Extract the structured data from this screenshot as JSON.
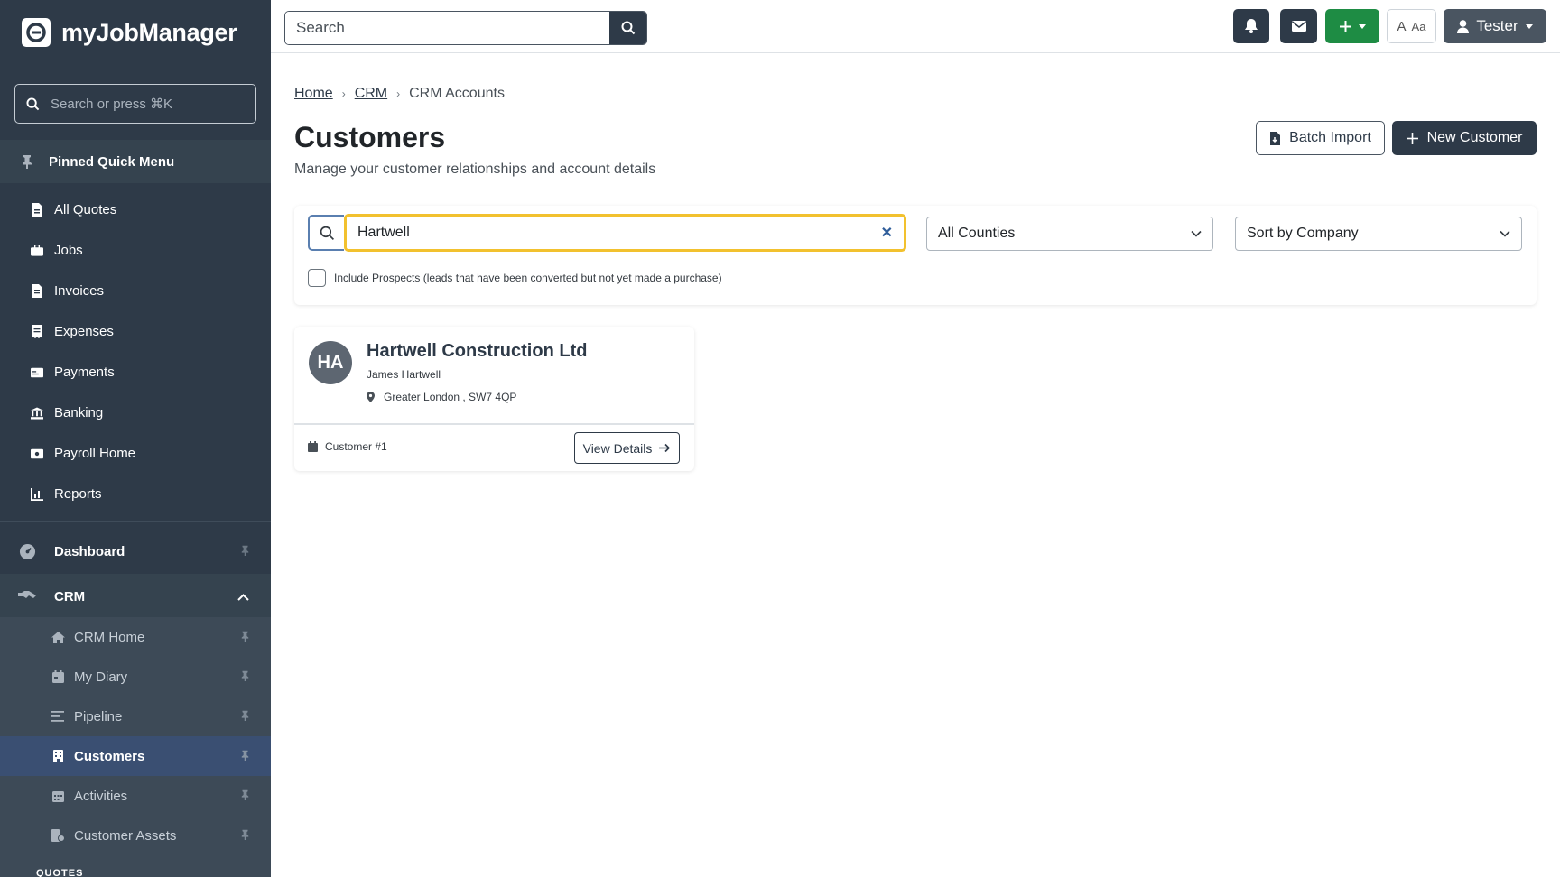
{
  "app": {
    "name": "myJobManager"
  },
  "sidebar": {
    "search_placeholder": "Search or press ⌘K",
    "pinned_title": "Pinned Quick Menu",
    "quick_items": [
      {
        "label": "All Quotes",
        "icon": "file-icon"
      },
      {
        "label": "Jobs",
        "icon": "briefcase-icon"
      },
      {
        "label": "Invoices",
        "icon": "invoice-icon"
      },
      {
        "label": "Expenses",
        "icon": "receipt-icon"
      },
      {
        "label": "Payments",
        "icon": "card-icon"
      },
      {
        "label": "Banking",
        "icon": "bank-icon"
      },
      {
        "label": "Payroll Home",
        "icon": "money-icon"
      },
      {
        "label": "Reports",
        "icon": "chart-icon"
      }
    ],
    "dashboard_label": "Dashboard",
    "crm_label": "CRM",
    "crm_items": [
      {
        "label": "CRM Home",
        "icon": "home-icon"
      },
      {
        "label": "My Diary",
        "icon": "calendar-icon"
      },
      {
        "label": "Pipeline",
        "icon": "list-icon"
      },
      {
        "label": "Customers",
        "icon": "building-icon",
        "active": true
      },
      {
        "label": "Activities",
        "icon": "calendar-grid-icon"
      },
      {
        "label": "Customer Assets",
        "icon": "assets-icon"
      }
    ],
    "section_label": "QUOTES"
  },
  "topbar": {
    "search_placeholder": "Search",
    "font_toggle_label": "Aa",
    "user_name": "Tester"
  },
  "breadcrumb": {
    "home": "Home",
    "crm": "CRM",
    "current": "CRM Accounts"
  },
  "page": {
    "title": "Customers",
    "subtitle": "Manage your customer relationships and account details",
    "batch_import_label": "Batch Import",
    "new_customer_label": "New Customer"
  },
  "filters": {
    "search_value": "Hartwell",
    "county_selected": "All Counties",
    "sort_selected": "Sort by Company",
    "include_prospects_label": "Include Prospects (leads that have been converted but not yet made a purchase)",
    "include_prospects_checked": false
  },
  "customers": [
    {
      "initials": "HA",
      "company": "Hartwell Construction Ltd",
      "contact": "James Hartwell",
      "location": "Greater London , SW7 4QP",
      "number": "Customer #1",
      "view_label": "View Details"
    }
  ],
  "colors": {
    "sidebar_bg": "#2e3a48",
    "active_item": "#3a4f72",
    "primary": "#2e3a48",
    "success": "#1e8c44",
    "focus_ring": "#f2c12e"
  }
}
